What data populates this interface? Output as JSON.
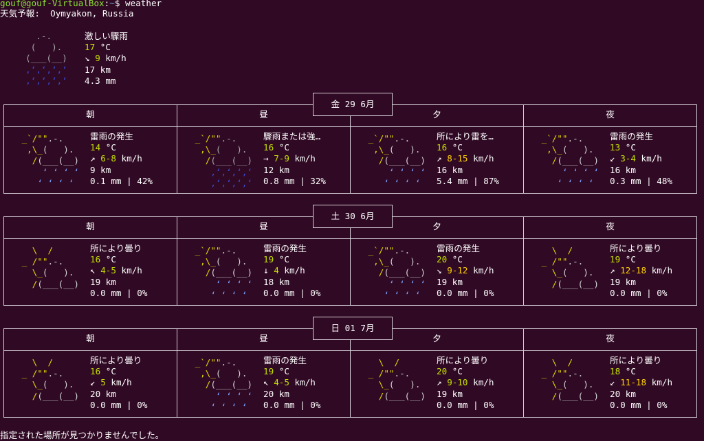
{
  "prompt": {
    "user_host": "gouf@gouf-VirtualBox",
    "path": "~",
    "symbol": "$",
    "command": "weather"
  },
  "report_header": "天気予報:  Oymyakon, Russia",
  "current": {
    "condition": "激しい驟雨",
    "temp": "17",
    "temp_unit": "°C",
    "wind_arrow": "↘",
    "wind": "9",
    "wind_unit": "km/h",
    "visibility": "17 km",
    "precip": "4.3 mm"
  },
  "days": [
    {
      "date": "金 29 6月",
      "periods": [
        {
          "title": "朝",
          "icon": "thunder",
          "condition": "雷雨の発生",
          "temp": "14",
          "arrow": "↗",
          "wind": "6-8",
          "vis": "9 km",
          "precip": "0.1 mm | 42%"
        },
        {
          "title": "昼",
          "icon": "heavyrain",
          "condition": "驟雨または強…",
          "temp": "16",
          "arrow": "→",
          "wind": "7-9",
          "vis": "12 km",
          "precip": "0.8 mm | 32%"
        },
        {
          "title": "夕",
          "icon": "thunder",
          "condition": "所により雷を…",
          "temp": "16",
          "arrow": "↗",
          "wind": "8-15",
          "vis": "16 km",
          "precip": "5.4 mm | 87%"
        },
        {
          "title": "夜",
          "icon": "thunder",
          "condition": "雷雨の発生",
          "temp": "13",
          "arrow": "↙",
          "wind": "3-4",
          "vis": "16 km",
          "precip": "0.3 mm | 48%"
        }
      ]
    },
    {
      "date": "土 30 6月",
      "periods": [
        {
          "title": "朝",
          "icon": "partly",
          "condition": "所により曇り",
          "temp": "16",
          "arrow": "↖",
          "wind": "4-5",
          "vis": "19 km",
          "precip": "0.0 mm | 0%"
        },
        {
          "title": "昼",
          "icon": "thunder",
          "condition": "雷雨の発生",
          "temp": "19",
          "arrow": "↓",
          "wind": "4",
          "vis": "18 km",
          "precip": "0.0 mm | 0%"
        },
        {
          "title": "夕",
          "icon": "thunder",
          "condition": "雷雨の発生",
          "temp": "20",
          "arrow": "↘",
          "wind": "9-12",
          "vis": "19 km",
          "precip": "0.0 mm | 0%"
        },
        {
          "title": "夜",
          "icon": "partly",
          "condition": "所により曇り",
          "temp": "19",
          "arrow": "↗",
          "wind": "12-18",
          "vis": "19 km",
          "precip": "0.0 mm | 0%"
        }
      ]
    },
    {
      "date": "日 01 7月",
      "periods": [
        {
          "title": "朝",
          "icon": "partly",
          "condition": "所により曇り",
          "temp": "16",
          "arrow": "↙",
          "wind": "5",
          "vis": "20 km",
          "precip": "0.0 mm | 0%"
        },
        {
          "title": "昼",
          "icon": "thunder",
          "condition": "雷雨の発生",
          "temp": "19",
          "arrow": "↖",
          "wind": "4-5",
          "vis": "20 km",
          "precip": "0.0 mm | 0%"
        },
        {
          "title": "夕",
          "icon": "partly",
          "condition": "所により曇り",
          "temp": "20",
          "arrow": "↗",
          "wind": "9-10",
          "vis": "19 km",
          "precip": "0.0 mm | 0%"
        },
        {
          "title": "夜",
          "icon": "partly",
          "condition": "所により曇り",
          "temp": "18",
          "arrow": "↙",
          "wind": "11-18",
          "vis": "20 km",
          "precip": "0.0 mm | 0%"
        }
      ]
    }
  ],
  "temp_unit": "°C",
  "wind_unit": "km/h",
  "footer": "指定された場所が見つかりませんでした。"
}
